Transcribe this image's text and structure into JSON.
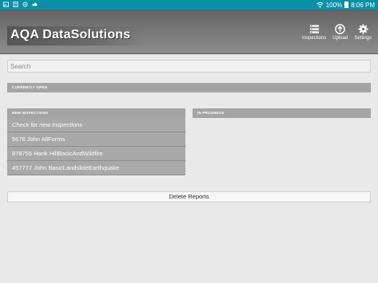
{
  "status_bar": {
    "battery": "100%",
    "time": "8:06 PM",
    "color": "#0b8fa8"
  },
  "app": {
    "title": "AQA DataSolutions"
  },
  "actions": [
    {
      "label": "Inspections",
      "icon": "inspections-icon"
    },
    {
      "label": "Upload",
      "icon": "upload-icon"
    },
    {
      "label": "Settings",
      "icon": "gear-icon"
    }
  ],
  "search": {
    "placeholder": "Search",
    "value": ""
  },
  "sections": {
    "currently_open": "CURRENTLY OPEN",
    "new_inspections": "NEW INSPECTIONS",
    "in_progress": "IN PROGRESS"
  },
  "new_inspections": {
    "check_label": "Check for new Inspections",
    "items": [
      "5678 John AllForms",
      "878755 Hank HillBasicAndWildfire",
      "457777 John BasicLandslideEarthquake"
    ]
  },
  "delete_button": "Delete Reports"
}
